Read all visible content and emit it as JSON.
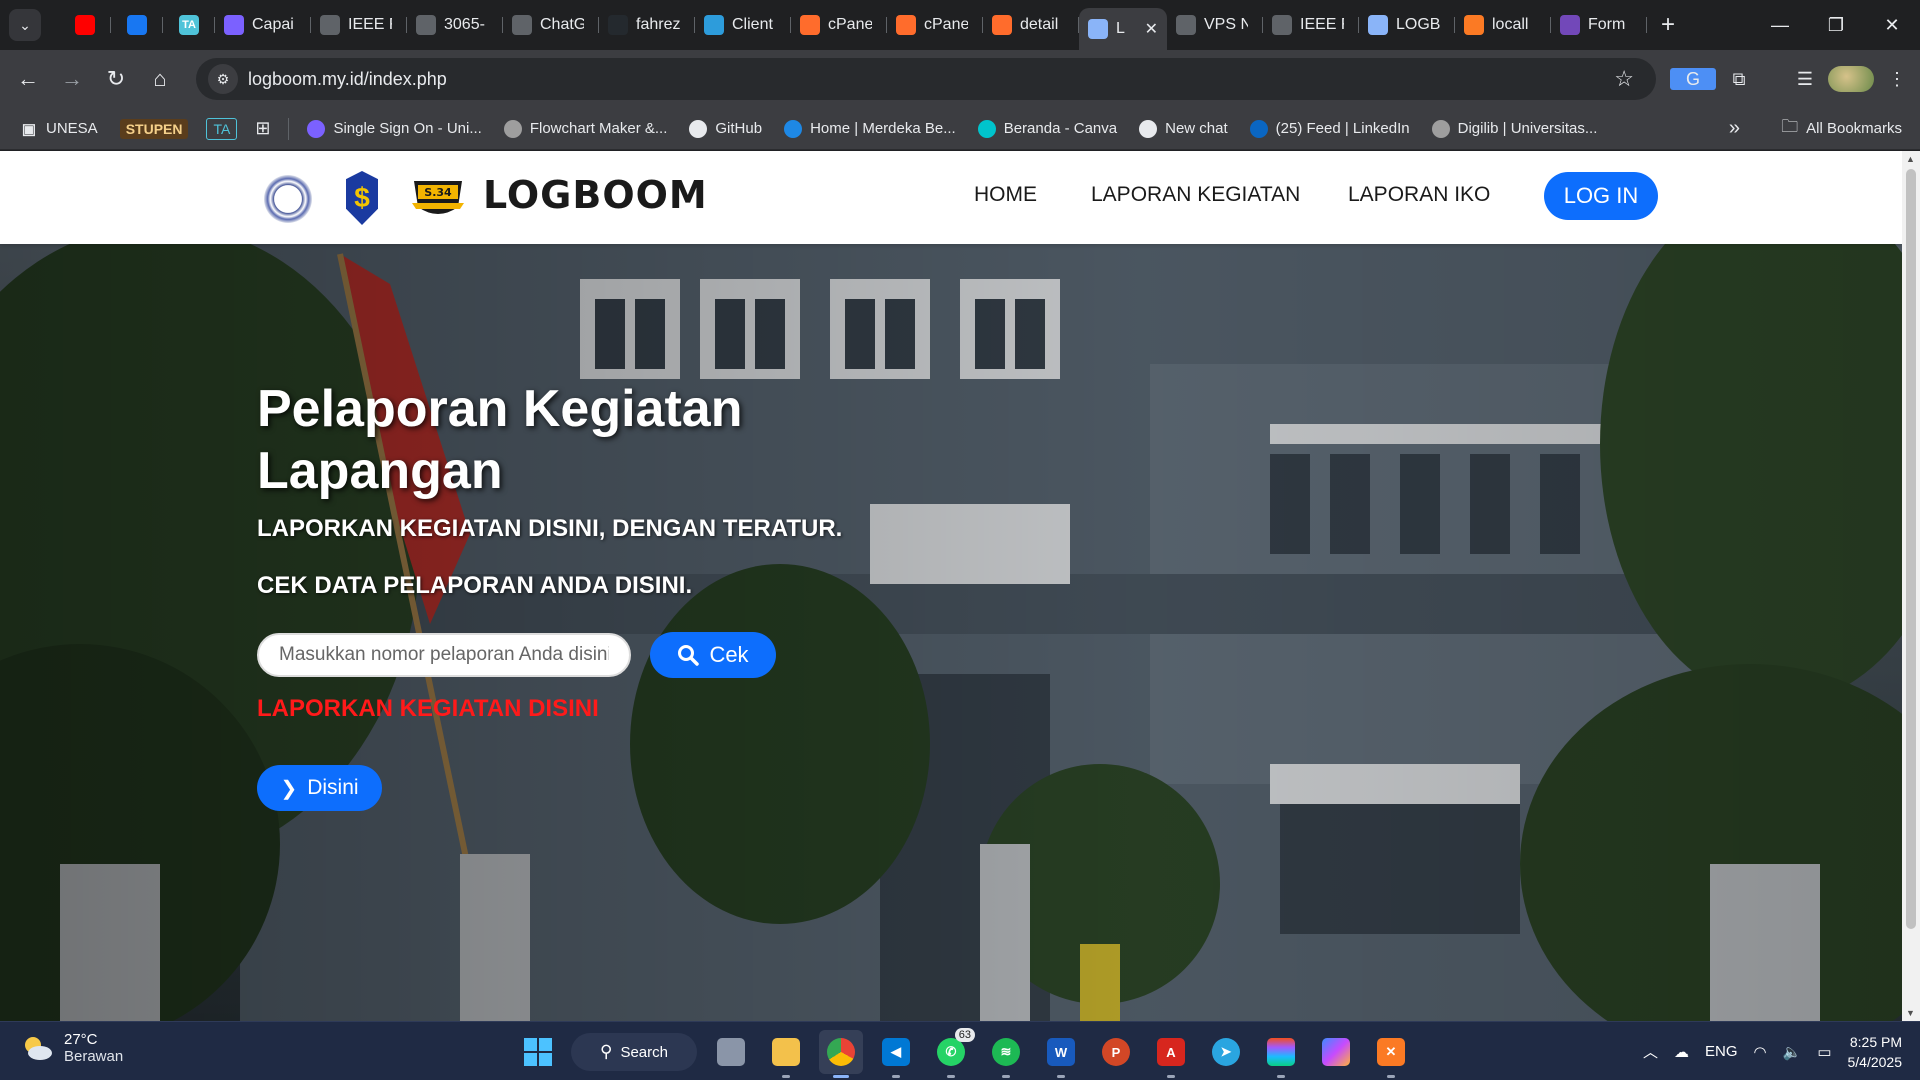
{
  "browser": {
    "tabs": [
      {
        "label": "",
        "icon": "youtube-icon",
        "color": "#ff0000",
        "pinned": true
      },
      {
        "label": "",
        "icon": "facebook-icon",
        "color": "#1877f2",
        "pinned": true
      },
      {
        "label": "TA",
        "icon": "ta-icon",
        "color": "#4fc3d9",
        "pinned": true
      },
      {
        "label": "Capai",
        "icon": "capai-icon",
        "color": "#7b61ff"
      },
      {
        "label": "IEEE F",
        "icon": "globe-icon",
        "color": "#5f6368"
      },
      {
        "label": "3065-",
        "icon": "globe-icon",
        "color": "#5f6368"
      },
      {
        "label": "ChatG",
        "icon": "chatgpt-icon",
        "color": "#5f6368"
      },
      {
        "label": "fahrez",
        "icon": "github-icon",
        "color": "#24292e"
      },
      {
        "label": "Client",
        "icon": "client-icon",
        "color": "#2d9cdb"
      },
      {
        "label": "cPane",
        "icon": "cpanel-icon",
        "color": "#ff6c2c"
      },
      {
        "label": "cPane",
        "icon": "cpanel-icon",
        "color": "#ff6c2c"
      },
      {
        "label": "detail",
        "icon": "cpanel-icon",
        "color": "#ff6c2c"
      },
      {
        "label": "L",
        "icon": "loading-icon",
        "color": "#8ab4f8",
        "active": true
      },
      {
        "label": "VPS N",
        "icon": "globe-icon",
        "color": "#5f6368"
      },
      {
        "label": "IEEE F",
        "icon": "globe-icon",
        "color": "#5f6368"
      },
      {
        "label": "LOGB",
        "icon": "loading-icon",
        "color": "#8ab4f8"
      },
      {
        "label": "locall",
        "icon": "xampp-icon",
        "color": "#fb7a24"
      },
      {
        "label": "Form",
        "icon": "forms-icon",
        "color": "#7248b9"
      }
    ],
    "url": "logboom.my.id/index.php",
    "bookmarks": {
      "unesa": "UNESA",
      "stupen": "STUPEN",
      "ta": "TA",
      "items": [
        {
          "label": "Single Sign On - Uni...",
          "icon": "sso-icon",
          "color": "#7b61ff"
        },
        {
          "label": "Flowchart Maker &...",
          "icon": "flowchart-icon",
          "color": "#9e9e9e"
        },
        {
          "label": "GitHub",
          "icon": "github-icon",
          "color": "#e8eaed"
        },
        {
          "label": "Home | Merdeka Be...",
          "icon": "merdeka-icon",
          "color": "#1e88e5"
        },
        {
          "label": "Beranda - Canva",
          "icon": "canva-icon",
          "color": "#00c4cc"
        },
        {
          "label": "New chat",
          "icon": "chatgpt-icon",
          "color": "#e8eaed"
        },
        {
          "label": "(25) Feed | LinkedIn",
          "icon": "linkedin-icon",
          "color": "#0a66c2"
        },
        {
          "label": "Digilib | Universitas...",
          "icon": "globe-icon",
          "color": "#9e9e9e"
        }
      ],
      "all": "All Bookmarks"
    }
  },
  "site": {
    "brand": "LOGBOOM",
    "badge_text": "S.34",
    "nav": {
      "home": "HOME",
      "kegiatan": "LAPORAN KEGIATAN",
      "iko": "LAPORAN IKO",
      "login": "LOG IN"
    },
    "hero": {
      "title": "Pelaporan Kegiatan Lapangan",
      "sub1": "LAPORKAN KEGIATAN DISINI, DENGAN TERATUR.",
      "sub2": "CEK DATA PELAPORAN ANDA DISINI.",
      "search_placeholder": "Masukkan nomor pelaporan Anda disini",
      "search_value": "",
      "cek_label": "Cek",
      "link": "LAPORKAN KEGIATAN DISINI",
      "disini_label": "Disini"
    },
    "colors": {
      "primary": "#0d6efd",
      "link_red": "#ff1a1a"
    }
  },
  "taskbar": {
    "weather_temp": "27°C",
    "weather_desc": "Berawan",
    "search_label": "Search",
    "whatsapp_badge": "63",
    "lang": "ENG",
    "time": "8:25 PM",
    "date": "5/4/2025"
  }
}
